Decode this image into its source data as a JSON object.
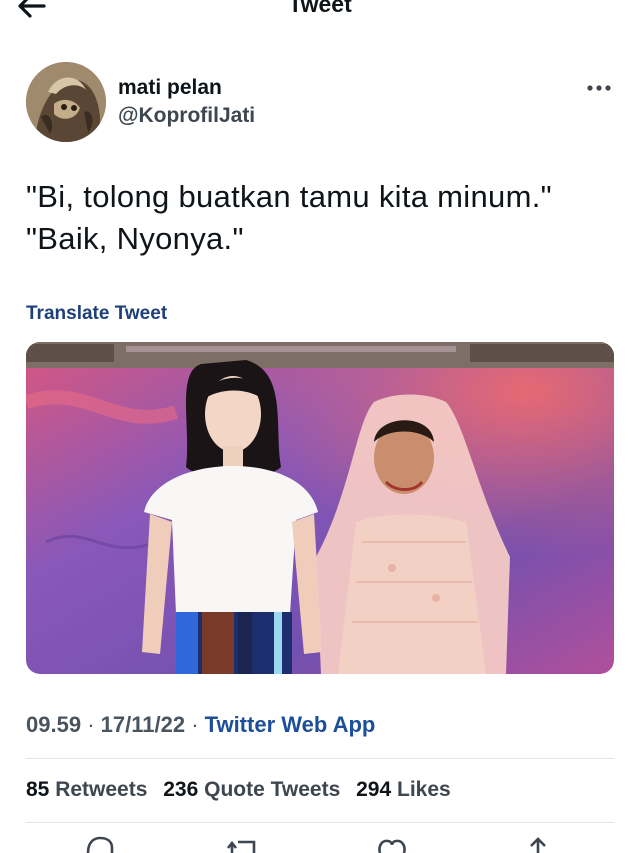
{
  "header": {
    "title": "Tweet"
  },
  "author": {
    "name": "mati pelan",
    "handle": "@KoprofilJati"
  },
  "tweet": {
    "lines": [
      "\"Bi, tolong buatkan tamu kita minum.\"",
      "\"Baik, Nyonya.\""
    ],
    "translate_label": "Translate Tweet",
    "time": "09.59",
    "sep1": "·",
    "date": "17/11/22",
    "sep2": "·",
    "app": "Twitter Web App"
  },
  "stats": [
    {
      "count": "85",
      "label": "Retweets"
    },
    {
      "count": "236",
      "label": "Quote Tweets"
    },
    {
      "count": "294",
      "label": "Likes"
    }
  ],
  "icons": {
    "back": "arrow-left-icon",
    "more": "more-dots-icon",
    "reply": "reply-icon",
    "retweet": "retweet-icon",
    "like": "heart-icon",
    "share": "share-icon"
  },
  "colors": {
    "link": "#1d4e9a",
    "translate": "#1d3f7a",
    "text": "#0f1419",
    "muted": "#4a5460"
  }
}
